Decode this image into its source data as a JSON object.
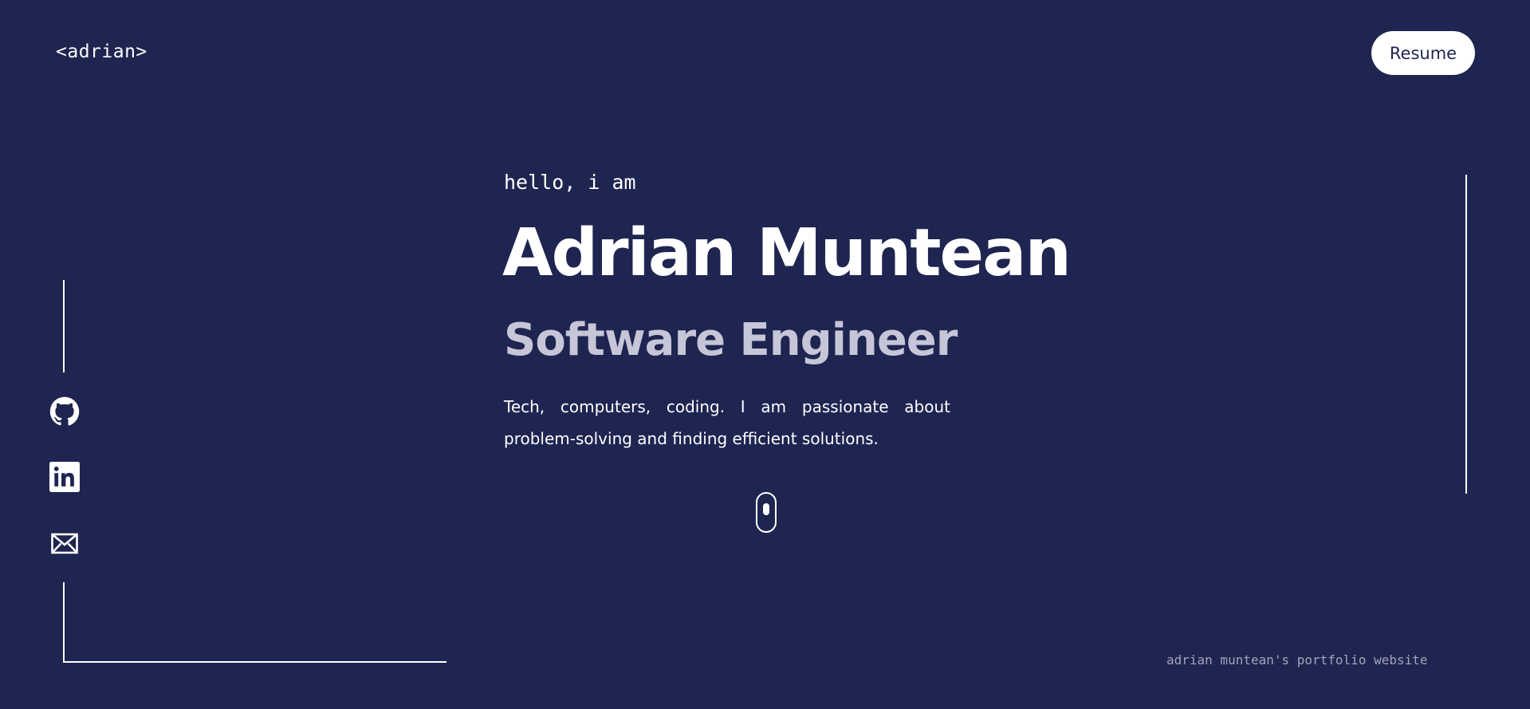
{
  "header": {
    "logo": "<adrian>",
    "resume_label": "Resume"
  },
  "social": {
    "items": [
      {
        "icon": "github-icon"
      },
      {
        "icon": "linkedin-icon"
      },
      {
        "icon": "mail-icon"
      }
    ]
  },
  "hero": {
    "greeting": "hello, i am",
    "name": "Adrian Muntean",
    "role": "Software Engineer",
    "bio": "Tech, computers, coding. I am passionate about problem-solving and finding efficient solutions."
  },
  "footer": {
    "note": "adrian muntean's portfolio website"
  },
  "colors": {
    "background": "#1f2551",
    "text": "#ffffff",
    "role_text": "#c6c6d8",
    "footer_text": "#a2a4b8"
  }
}
